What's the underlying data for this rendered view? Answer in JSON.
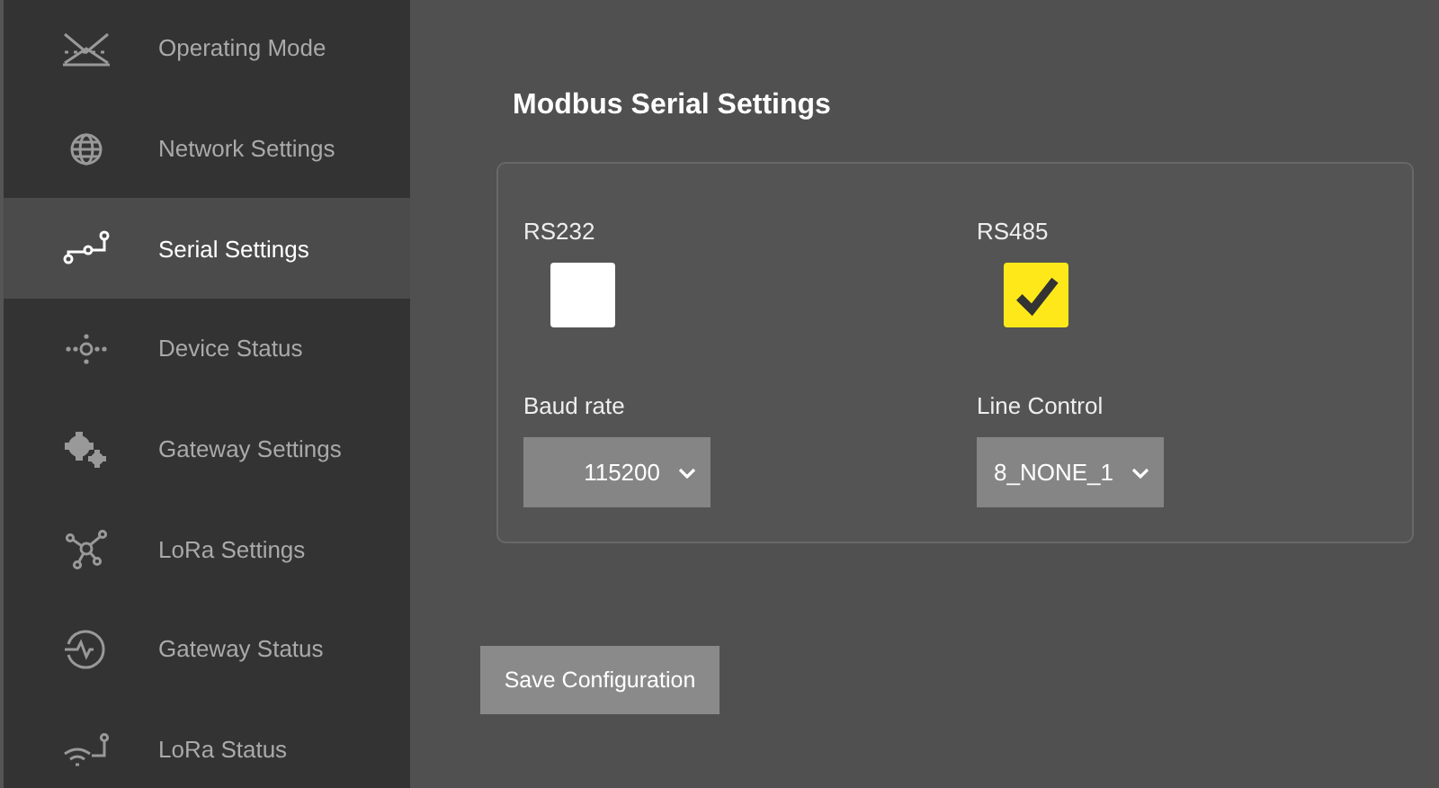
{
  "sidebar": {
    "items": [
      {
        "label": "Operating Mode",
        "selected": false
      },
      {
        "label": "Network Settings",
        "selected": false
      },
      {
        "label": "Serial Settings",
        "selected": true
      },
      {
        "label": "Device Status",
        "selected": false
      },
      {
        "label": "Gateway Settings",
        "selected": false
      },
      {
        "label": "LoRa Settings",
        "selected": false
      },
      {
        "label": "Gateway Status",
        "selected": false
      },
      {
        "label": "LoRa Status",
        "selected": false
      }
    ]
  },
  "title": "Modbus Serial Settings",
  "interfaces": [
    {
      "label": "RS232",
      "checked": false
    },
    {
      "label": "RS485",
      "checked": true
    }
  ],
  "selects": [
    {
      "label": "Baud rate",
      "value": "115200"
    },
    {
      "label": "Line Control",
      "value": "8_NONE_1"
    }
  ],
  "save_button": "Save Configuration"
}
